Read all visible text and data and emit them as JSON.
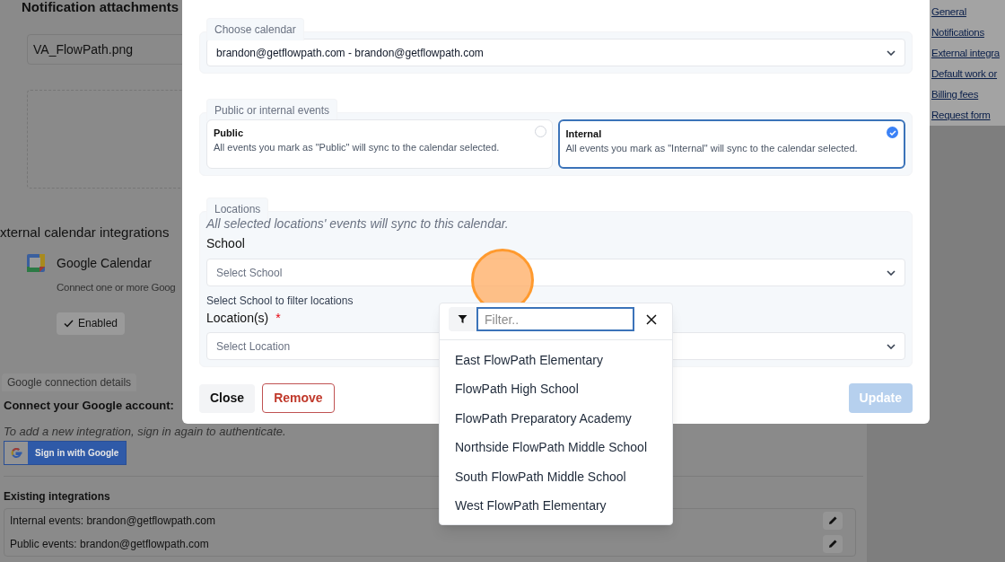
{
  "background_page": {
    "attachments_heading": "Notification attachments",
    "attachment_file": "VA_FlowPath.png",
    "integrations_heading": "xternal calendar integrations",
    "provider": {
      "name": "Google Calendar",
      "description": "Connect one or more Goog",
      "status_button": "Enabled"
    },
    "connection_tab": "Google connection details",
    "connect_heading": "Connect your Google account:",
    "hint": "To add a new integration, sign in again to authenticate.",
    "sign_in_button": "Sign in with Google",
    "existing_heading": "Existing integrations",
    "existing": [
      {
        "label": "Internal events: brandon@getflowpath.com"
      },
      {
        "label": "Public events: brandon@getflowpath.com"
      }
    ]
  },
  "side_nav": [
    {
      "label": "General"
    },
    {
      "label": "Notifications"
    },
    {
      "label": "External integra"
    },
    {
      "label": "Default work or"
    },
    {
      "label": "Billing fees"
    },
    {
      "label": "Request form"
    }
  ],
  "modal": {
    "calendar_section": {
      "legend": "Choose calendar",
      "value": "brandon@getflowpath.com - brandon@getflowpath.com"
    },
    "events_section": {
      "legend": "Public or internal events",
      "options": [
        {
          "title": "Public",
          "description": "All events you mark as \"Public\" will sync to the calendar selected.",
          "selected": false
        },
        {
          "title": "Internal",
          "description": "All events you mark as \"Internal\" will sync to the calendar selected.",
          "selected": true
        }
      ]
    },
    "locations_section": {
      "legend": "Locations",
      "note": "All selected locations' events will sync to this calendar.",
      "school_label": "School",
      "school_placeholder": "Select School",
      "school_hint": "Select School to filter locations",
      "location_label": "Location(s)",
      "required_mark": "*",
      "location_placeholder": "Select Location"
    },
    "buttons": {
      "close": "Close",
      "remove": "Remove",
      "update": "Update",
      "update_disabled": true
    }
  },
  "dropdown": {
    "filter_placeholder": "Filter..",
    "items": [
      {
        "label": "East FlowPath Elementary"
      },
      {
        "label": "FlowPath High School"
      },
      {
        "label": "FlowPath Preparatory Academy"
      },
      {
        "label": "Northside FlowPath Middle School"
      },
      {
        "label": "South FlowPath Middle School"
      },
      {
        "label": "West FlowPath Elementary"
      }
    ]
  }
}
